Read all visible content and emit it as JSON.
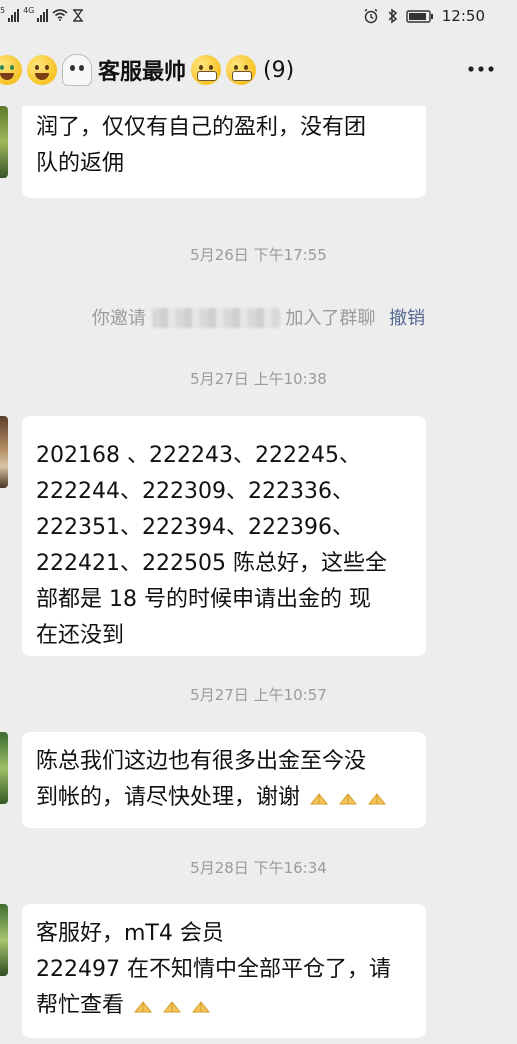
{
  "status_bar": {
    "left_small_labels": [
      "5",
      "4G"
    ],
    "time": "12:50",
    "icons": [
      "signal-icon",
      "signal-icon",
      "wifi-icon",
      "hourglass-icon",
      "alarm-icon",
      "bluetooth-icon",
      "battery-icon"
    ]
  },
  "chat_header": {
    "title": "客服最帅",
    "member_count": "(9)",
    "title_emojis": [
      "money-mouth-face-icon",
      "hugging-face-icon",
      "ghost-icon",
      "grimacing-face-icon",
      "grimacing-face-icon"
    ],
    "more_icon": "more-icon"
  },
  "messages": [
    {
      "kind": "text",
      "lines": [
        "润了，仅仅有自己的盈利，没有团",
        "队的返佣"
      ]
    },
    {
      "kind": "timestamp",
      "text": "5月26日 下午17:55"
    },
    {
      "kind": "system",
      "prefix": "你邀请",
      "suffix": "加入了群聊",
      "action": "撤销"
    },
    {
      "kind": "timestamp",
      "text": "5月27日 上午10:38"
    },
    {
      "kind": "text",
      "lines": [
        "202168 、222243、222245、",
        "222244、222309、222336、",
        "222351、222394、222396、",
        "222421、222505 陈总好，这些全",
        "部都是 18 号的时候申请出金的  现",
        "在还没到"
      ]
    },
    {
      "kind": "timestamp",
      "text": "5月27日 上午10:57"
    },
    {
      "kind": "text",
      "lines": [
        "陈总我们这边也有很多出金至今没",
        "到帐的，请尽快处理，谢谢"
      ],
      "trailing_icons": [
        "folded-hands-icon",
        "folded-hands-icon",
        "folded-hands-icon"
      ]
    },
    {
      "kind": "timestamp",
      "text": "5月28日 下午16:34"
    },
    {
      "kind": "text",
      "lines": [
        "客服好，mT4 会员",
        "222497 在不知情中全部平仓了，请",
        "帮忙查看"
      ],
      "trailing_icons": [
        "folded-hands-icon",
        "folded-hands-icon",
        "folded-hands-icon"
      ]
    }
  ]
}
